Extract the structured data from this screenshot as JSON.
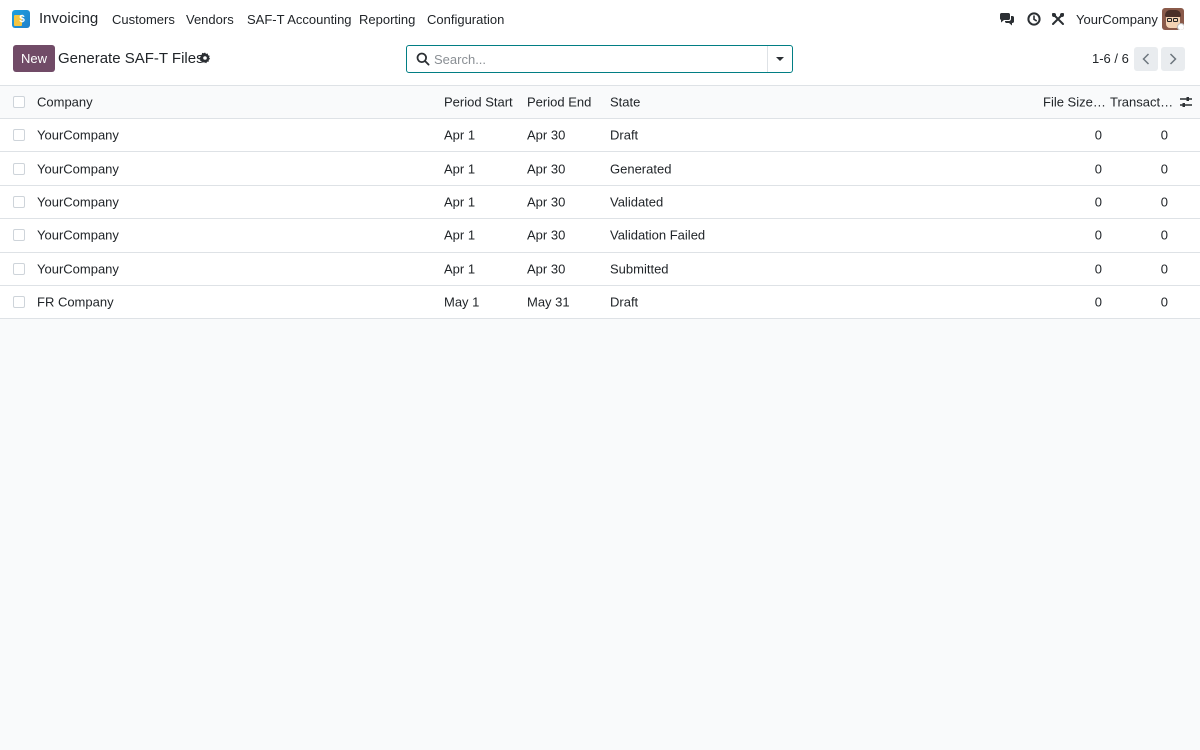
{
  "navbar": {
    "app_name": "Invoicing",
    "menu": [
      "Customers",
      "Vendors",
      "SAF-T Accounting",
      "Reporting",
      "Configuration"
    ],
    "company": "YourCompany",
    "icons": [
      "messaging-icon",
      "activity-clock-icon",
      "debug-tools-icon",
      "user-avatar"
    ]
  },
  "control": {
    "new_label": "New",
    "title": "Generate SAF-T Files",
    "search_placeholder": "Search...",
    "pager": "1-6 / 6"
  },
  "table": {
    "headers": [
      "Company",
      "Period Start",
      "Period End",
      "State",
      "File Size…",
      "Transact…"
    ],
    "rows": [
      {
        "company": "YourCompany",
        "start": "Apr 1",
        "end": "Apr 30",
        "state": "Draft",
        "size": "0",
        "tx": "0"
      },
      {
        "company": "YourCompany",
        "start": "Apr 1",
        "end": "Apr 30",
        "state": "Generated",
        "size": "0",
        "tx": "0"
      },
      {
        "company": "YourCompany",
        "start": "Apr 1",
        "end": "Apr 30",
        "state": "Validated",
        "size": "0",
        "tx": "0"
      },
      {
        "company": "YourCompany",
        "start": "Apr 1",
        "end": "Apr 30",
        "state": "Validation Failed",
        "size": "0",
        "tx": "0"
      },
      {
        "company": "YourCompany",
        "start": "Apr 1",
        "end": "Apr 30",
        "state": "Submitted",
        "size": "0",
        "tx": "0"
      },
      {
        "company": "FR Company",
        "start": "May 1",
        "end": "May 31",
        "state": "Draft",
        "size": "0",
        "tx": "0"
      }
    ]
  },
  "colors": {
    "primary": "#714b67",
    "accent": "#017e84",
    "border": "#dee2e6",
    "background": "#f9fafb"
  }
}
